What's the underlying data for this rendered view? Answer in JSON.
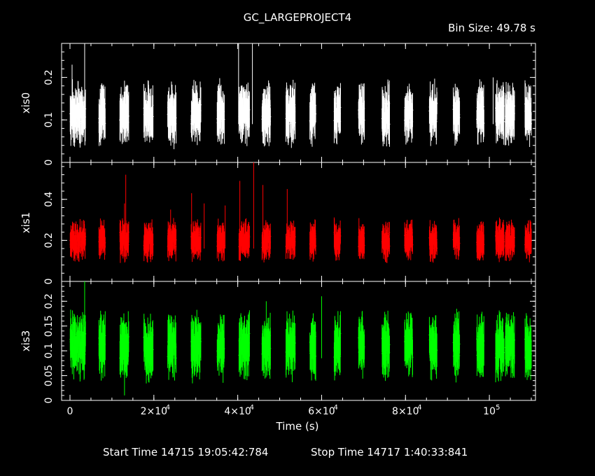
{
  "header": {
    "title": "GC_LARGEPROJECT4",
    "bin_size": "Bin Size: 49.78 s"
  },
  "footer": {
    "start_time": "Start Time 14715 19:05:42:784",
    "stop_time": "Stop Time 14717  1:40:33:841"
  },
  "colors": {
    "xis0": "#ffffff",
    "xis1": "#ff0000",
    "xis3": "#00ff00",
    "background": "#000000",
    "axes": "#ffffff"
  },
  "chart_data": {
    "type": "scatter",
    "xlabel": "Time (s)",
    "xlim": [
      -2000,
      111000
    ],
    "x_ticks": [
      {
        "value": 0,
        "label": "0"
      },
      {
        "value": 20000,
        "label": "2×10",
        "exp": "4"
      },
      {
        "value": 40000,
        "label": "4×10",
        "exp": "4"
      },
      {
        "value": 60000,
        "label": "6×10",
        "exp": "4"
      },
      {
        "value": 80000,
        "label": "8×10",
        "exp": "4"
      },
      {
        "value": 100000,
        "label": "10",
        "exp": "5"
      }
    ],
    "panels": [
      {
        "name": "xis0",
        "ylabel": "xis0",
        "ylim": [
          0,
          0.28
        ],
        "y_ticks": [
          {
            "value": 0,
            "label": "0"
          },
          {
            "value": 0.1,
            "label": "0.1"
          },
          {
            "value": 0.2,
            "label": "0.2"
          }
        ],
        "base": 0.115,
        "spread": 0.025,
        "err": 0.04,
        "segments": [
          [
            50,
            2600
          ],
          [
            2700,
            3700
          ],
          [
            6900,
            8400
          ],
          [
            11900,
            14000
          ],
          [
            17600,
            19800
          ],
          [
            23300,
            25300
          ],
          [
            28900,
            31200
          ],
          [
            35100,
            36800
          ],
          [
            40300,
            42800
          ],
          [
            45800,
            47800
          ],
          [
            51500,
            53700
          ],
          [
            57200,
            58600
          ],
          [
            63000,
            64500
          ],
          [
            68800,
            70200
          ],
          [
            74400,
            76200
          ],
          [
            79800,
            81700
          ],
          [
            85700,
            87500
          ],
          [
            91400,
            92900
          ],
          [
            97000,
            98700
          ],
          [
            101500,
            103500
          ],
          [
            103800,
            106000
          ],
          [
            108500,
            110000
          ]
        ],
        "spikes": [
          {
            "x": 500,
            "y": 0.23
          },
          {
            "x": 3500,
            "y": 0.28
          },
          {
            "x": 40200,
            "y": 0.28
          },
          {
            "x": 43500,
            "y": 0.28
          },
          {
            "x": 41000,
            "y": 0.05
          },
          {
            "x": 100900,
            "y": 0.2
          }
        ]
      },
      {
        "name": "xis1",
        "ylabel": "xis1",
        "ylim": [
          0,
          0.58
        ],
        "y_ticks": [
          {
            "value": 0,
            "label": "0"
          },
          {
            "value": 0.2,
            "label": "0.2"
          },
          {
            "value": 0.4,
            "label": "0.4"
          }
        ],
        "base": 0.2,
        "spread": 0.04,
        "err": 0.05,
        "segments": [
          [
            50,
            2600
          ],
          [
            2700,
            3700
          ],
          [
            6900,
            8400
          ],
          [
            11900,
            14000
          ],
          [
            17600,
            19800
          ],
          [
            23300,
            25300
          ],
          [
            28900,
            31200
          ],
          [
            35100,
            36800
          ],
          [
            40300,
            42800
          ],
          [
            45800,
            47800
          ],
          [
            51500,
            53700
          ],
          [
            57200,
            58600
          ],
          [
            63000,
            64500
          ],
          [
            68800,
            70200
          ],
          [
            74400,
            76200
          ],
          [
            79800,
            81700
          ],
          [
            85700,
            87500
          ],
          [
            91400,
            92900
          ],
          [
            97000,
            98700
          ],
          [
            101500,
            103500
          ],
          [
            103800,
            106000
          ],
          [
            108500,
            110000
          ]
        ],
        "spikes": [
          {
            "x": 13300,
            "y": 0.52
          },
          {
            "x": 13000,
            "y": 0.38
          },
          {
            "x": 29000,
            "y": 0.43
          },
          {
            "x": 40500,
            "y": 0.49
          },
          {
            "x": 43800,
            "y": 0.58
          },
          {
            "x": 46000,
            "y": 0.47
          },
          {
            "x": 51800,
            "y": 0.45
          },
          {
            "x": 24000,
            "y": 0.35
          },
          {
            "x": 32000,
            "y": 0.38
          },
          {
            "x": 37000,
            "y": 0.37
          }
        ]
      },
      {
        "name": "xis3",
        "ylabel": "xis3",
        "ylim": [
          0,
          0.24
        ],
        "y_ticks": [
          {
            "value": 0,
            "label": "0"
          },
          {
            "value": 0.05,
            "label": "0.05"
          },
          {
            "value": 0.1,
            "label": "0.1"
          },
          {
            "value": 0.15,
            "label": "0.15"
          },
          {
            "value": 0.2,
            "label": "0.2"
          }
        ],
        "base": 0.11,
        "spread": 0.025,
        "err": 0.035,
        "segments": [
          [
            50,
            2600
          ],
          [
            2700,
            3700
          ],
          [
            6900,
            8400
          ],
          [
            11900,
            14000
          ],
          [
            17600,
            19800
          ],
          [
            23300,
            25300
          ],
          [
            28900,
            31200
          ],
          [
            35100,
            36800
          ],
          [
            40300,
            42800
          ],
          [
            45800,
            47800
          ],
          [
            51500,
            53700
          ],
          [
            57200,
            58600
          ],
          [
            63000,
            64500
          ],
          [
            68800,
            70200
          ],
          [
            74400,
            76200
          ],
          [
            79800,
            81700
          ],
          [
            85700,
            87500
          ],
          [
            91400,
            92900
          ],
          [
            97000,
            98700
          ],
          [
            101500,
            103500
          ],
          [
            103800,
            106000
          ],
          [
            108500,
            110000
          ]
        ],
        "spikes": [
          {
            "x": 3500,
            "y": 0.24
          },
          {
            "x": 46800,
            "y": 0.2
          },
          {
            "x": 60000,
            "y": 0.21
          },
          {
            "x": 13000,
            "y": 0.01
          }
        ]
      }
    ]
  }
}
